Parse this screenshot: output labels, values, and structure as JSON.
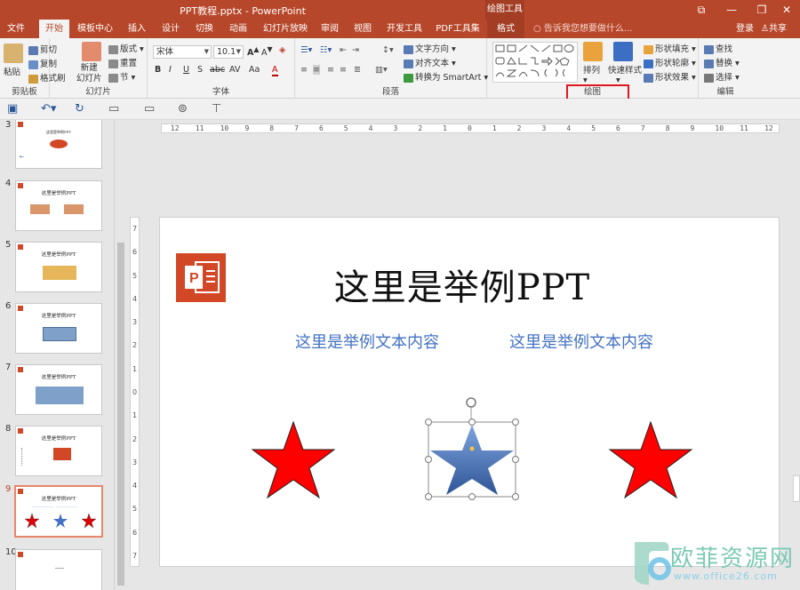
{
  "window": {
    "title": "PPT教程.pptx - PowerPoint",
    "context_tools": "绘图工具",
    "buttons": [
      "⧉",
      "—",
      "❐",
      "✕"
    ]
  },
  "tabs": [
    {
      "label": "文件"
    },
    {
      "label": "开始"
    },
    {
      "label": "模板中心"
    },
    {
      "label": "插入"
    },
    {
      "label": "设计"
    },
    {
      "label": "切换"
    },
    {
      "label": "动画"
    },
    {
      "label": "幻灯片放映"
    },
    {
      "label": "审阅"
    },
    {
      "label": "视图"
    },
    {
      "label": "开发工具"
    },
    {
      "label": "PDF工具集"
    },
    {
      "label": "格式"
    }
  ],
  "tell_me": "告诉我您想要做什么...",
  "login": "登录",
  "share": "共享",
  "ribbon": {
    "clipboard": {
      "label": "剪贴板",
      "paste": "粘贴",
      "cut": "剪切",
      "copy": "复制",
      "format_painter": "格式刷"
    },
    "slides": {
      "label": "幻灯片",
      "new_slide": "新建\n幻灯片",
      "layout": "版式",
      "reset": "重置",
      "section": "节"
    },
    "font": {
      "label": "字体",
      "font_name": "宋体",
      "font_size": "10.1",
      "bold": "B",
      "italic": "I",
      "underline": "U",
      "shadow": "S",
      "strike": "abc",
      "spacing": "AV",
      "case": "Aa",
      "color": "A"
    },
    "paragraph": {
      "label": "段落",
      "text_direction": "文字方向",
      "align_text": "对齐文本",
      "smartart": "转换为 SmartArt"
    },
    "drawing": {
      "label": "绘图",
      "arrange": "排列",
      "quick_styles": "快速样式",
      "shape_fill": "形状填充",
      "shape_outline": "形状轮廓",
      "shape_effects": "形状效果"
    },
    "editing": {
      "label": "编辑",
      "find": "查找",
      "replace": "替换",
      "select": "选择"
    }
  },
  "thumbnails": [
    {
      "num": "3",
      "title": "这里是举例PPT"
    },
    {
      "num": "4",
      "title": "这里是举例PPT"
    },
    {
      "num": "5",
      "title": "这里是举例PPT"
    },
    {
      "num": "6",
      "title": "这里是举例PPT"
    },
    {
      "num": "7",
      "title": "这里是举例PPT"
    },
    {
      "num": "8",
      "title": "这里是举例PPT"
    },
    {
      "num": "9",
      "title": "这里是举例PPT"
    },
    {
      "num": "10",
      "title": ""
    }
  ],
  "ruler_labels": {
    "horizontal": [
      "12",
      "11",
      "10",
      "9",
      "8",
      "7",
      "6",
      "5",
      "4",
      "3",
      "2",
      "1",
      "0",
      "1",
      "2",
      "3",
      "4",
      "5",
      "6",
      "7",
      "8",
      "9",
      "10",
      "11",
      "12"
    ],
    "vertical": [
      "7",
      "6",
      "5",
      "4",
      "3",
      "2",
      "1",
      "0",
      "1",
      "2",
      "3",
      "4",
      "5",
      "6",
      "7"
    ]
  },
  "slide": {
    "title": "这里是举例PPT",
    "subtitle_left": "这里是举例文本内容",
    "subtitle_right": "这里是举例文本内容"
  },
  "colors": {
    "brand": "#b7472a",
    "star_red": "#ff0000",
    "star_blue_top": "#7ea4dd",
    "star_blue_bottom": "#2f5597",
    "selection_highlight": "#e0161f"
  },
  "watermark": {
    "text": "欧菲资源网",
    "url": "www.office26.com"
  }
}
